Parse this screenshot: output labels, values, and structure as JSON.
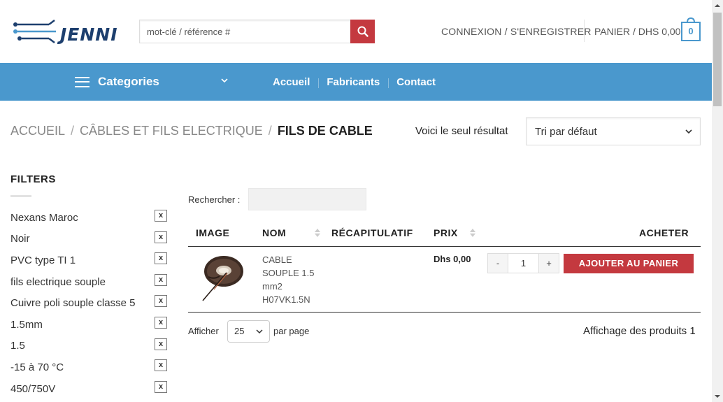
{
  "header": {
    "logo_text": "JENNI",
    "search_placeholder": "mot-clé / référence #",
    "login_label": "CONNEXION / S'ENREGISTRER",
    "cart_label": "PANIER / DHS 0,00",
    "cart_count": "0"
  },
  "nav": {
    "categories_label": "Categories",
    "links": [
      "Accueil",
      "Fabricants",
      "Contact"
    ]
  },
  "breadcrumb": {
    "items": [
      "ACCUEIL",
      "CÂBLES ET FILS ELECTRIQUE"
    ],
    "separator": "/",
    "current": "FILS DE CABLE"
  },
  "results": {
    "count_text": "Voici le seul résultat",
    "sort_selected": "Tri par défaut"
  },
  "sidebar": {
    "title": "FILTERS",
    "remove_glyph": "x",
    "filters": [
      "Nexans Maroc",
      "Noir",
      "PVC type TI 1",
      "fils electrique souple",
      "Cuivre poli souple classe 5",
      "1.5mm",
      "1.5",
      "-15 à 70 °C",
      "450/750V"
    ]
  },
  "table": {
    "search_label": "Rechercher :",
    "columns": [
      "IMAGE",
      "NOM",
      "RÉCAPITULATIF",
      "PRIX",
      "ACHETER"
    ],
    "rows": [
      {
        "name": "CABLE SOUPLE 1.5 mm2 H07VK1.5N",
        "price": "Dhs 0,00",
        "qty_minus": "-",
        "qty": "1",
        "qty_plus": "+",
        "add_label": "AJOUTER AU PANIER"
      }
    ],
    "show_label": "Afficher",
    "per_page_value": "25",
    "per_page_label": "par page",
    "info": "Affichage des produits 1"
  },
  "colors": {
    "nav_blue": "#4a98cd",
    "accent_red": "#c4393f",
    "logo_navy": "#1d3f6e"
  }
}
